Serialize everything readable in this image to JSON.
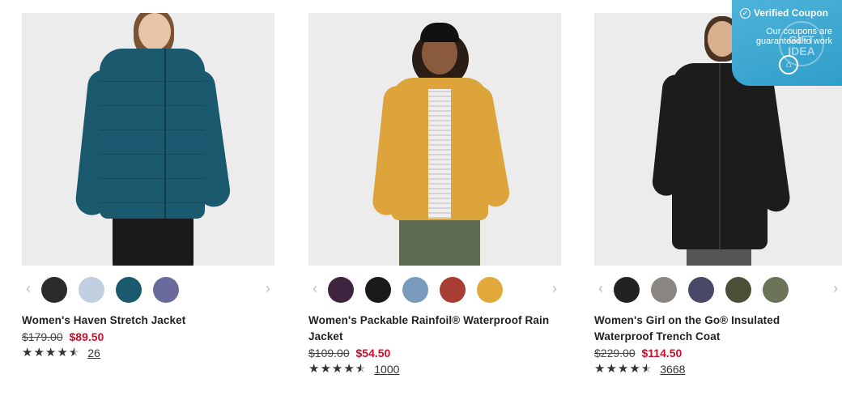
{
  "products": [
    {
      "name": "Women's Haven Stretch Jacket",
      "original_price": "$179.00",
      "sale_price": "$89.50",
      "rating": 4.5,
      "review_count": "26",
      "swatches": [
        "#2b2b2b",
        "#c2cfe0",
        "#1b5a6e",
        "#6b6a9c"
      ],
      "jacket_color": "#1b5a6e"
    },
    {
      "name": "Women's Packable Rainfoil® Waterproof Rain Jacket",
      "original_price": "$109.00",
      "sale_price": "$54.50",
      "rating": 4.5,
      "review_count": "1000",
      "swatches": [
        "#3f2440",
        "#1a1a1a",
        "#7a9bbe",
        "#a83e33",
        "#e2a93a"
      ],
      "jacket_color": "#dca43a"
    },
    {
      "name": "Women's Girl on the Go® Insulated Waterproof Trench Coat",
      "original_price": "$229.00",
      "sale_price": "$114.50",
      "rating": 4.5,
      "review_count": "3668",
      "swatches": [
        "#222222",
        "#8a8683",
        "#4a4868",
        "#4a5036",
        "#6b7459"
      ],
      "jacket_color": "#1c1c1c"
    }
  ],
  "coupon": {
    "title": "Verified Coupon",
    "subtitle": "Our coupons are guaranteed to work",
    "logo_text": "GIFT IDEA",
    "accent": "#3aa7d2"
  }
}
